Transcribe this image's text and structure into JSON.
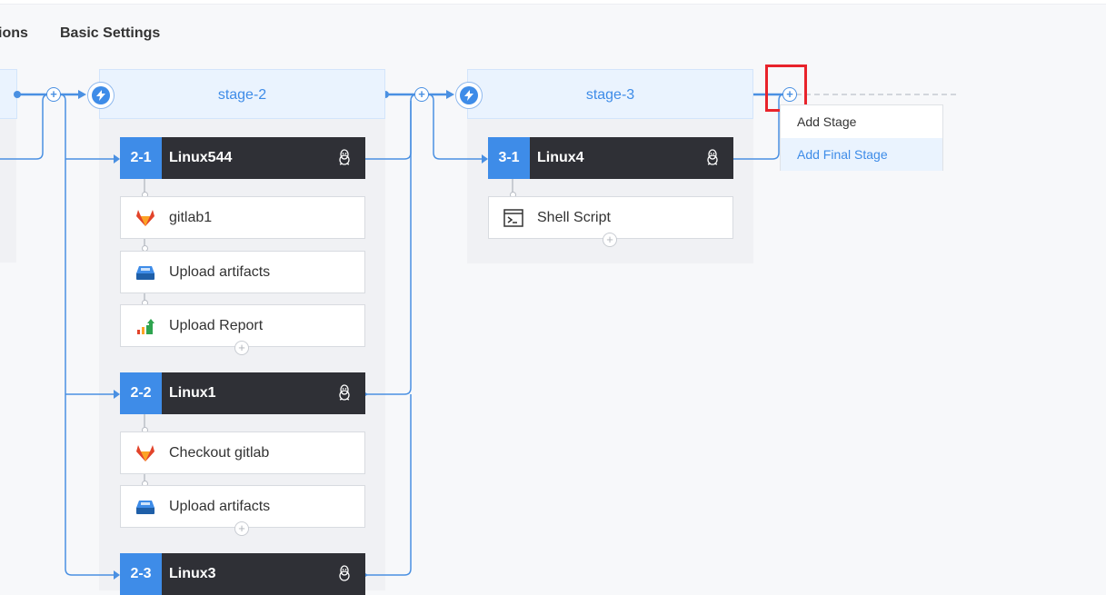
{
  "tabs": {
    "partial": "ions",
    "basic_settings": "Basic Settings"
  },
  "stages": [
    {
      "name": "stage-2",
      "jobs": [
        {
          "number": "2-1",
          "name": "Linux544",
          "os_icon": "linux-icon",
          "steps": [
            {
              "label": "gitlab1",
              "icon": "gitlab-icon"
            },
            {
              "label": "Upload artifacts",
              "icon": "upload-artifacts-icon"
            },
            {
              "label": "Upload Report",
              "icon": "upload-report-icon"
            }
          ]
        },
        {
          "number": "2-2",
          "name": "Linux1",
          "os_icon": "linux-icon",
          "steps": [
            {
              "label": "Checkout gitlab",
              "icon": "gitlab-icon"
            },
            {
              "label": "Upload artifacts",
              "icon": "upload-artifacts-icon"
            }
          ]
        },
        {
          "number": "2-3",
          "name": "Linux3",
          "os_icon": "linux-icon",
          "steps": []
        }
      ]
    },
    {
      "name": "stage-3",
      "jobs": [
        {
          "number": "3-1",
          "name": "Linux4",
          "os_icon": "linux-icon",
          "steps": [
            {
              "label": "Shell Script",
              "icon": "shell-script-icon"
            }
          ]
        }
      ]
    }
  ],
  "dropdown": {
    "items": [
      "Add Stage",
      "Add Final Stage"
    ],
    "active_index": 1
  },
  "colors": {
    "accent": "#3e8ce8",
    "job_header": "#2f3036",
    "highlight": "#e8232b"
  },
  "icons": {
    "plus": "+",
    "trigger": "lightning-icon"
  }
}
